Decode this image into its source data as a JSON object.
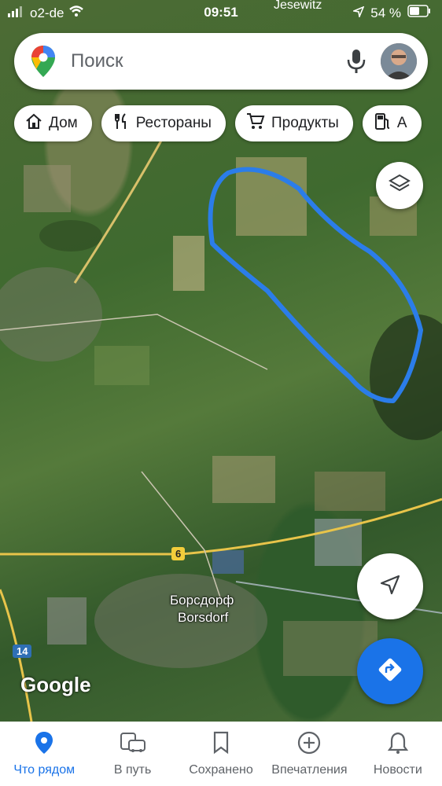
{
  "status_bar": {
    "carrier": "o2-de",
    "time": "09:51",
    "location_label": "Jesewitz",
    "battery": "54 %"
  },
  "search": {
    "placeholder": "Поиск"
  },
  "chips": [
    {
      "label": "Дом",
      "icon": "home-icon"
    },
    {
      "label": "Рестораны",
      "icon": "restaurant-icon"
    },
    {
      "label": "Продукты",
      "icon": "cart-icon"
    },
    {
      "label": "А",
      "icon": "gas-station-icon"
    }
  ],
  "map": {
    "google_logo": "Google",
    "town_ru": "Борсдорф",
    "town_de": "Borsdorf",
    "road_6": "6",
    "road_14": "14",
    "drawn_outline_color": "#2b7de9"
  },
  "bottom_nav": [
    {
      "label": "Что рядом",
      "icon": "pin-icon",
      "active": true
    },
    {
      "label": "В путь",
      "icon": "commute-icon",
      "active": false
    },
    {
      "label": "Сохранено",
      "icon": "bookmark-icon",
      "active": false
    },
    {
      "label": "Впечатления",
      "icon": "plus-circle-icon",
      "active": false
    },
    {
      "label": "Новости",
      "icon": "bell-icon",
      "active": false
    }
  ],
  "colors": {
    "accent": "#1a73e8",
    "road_yellow": "#e8c44a"
  }
}
